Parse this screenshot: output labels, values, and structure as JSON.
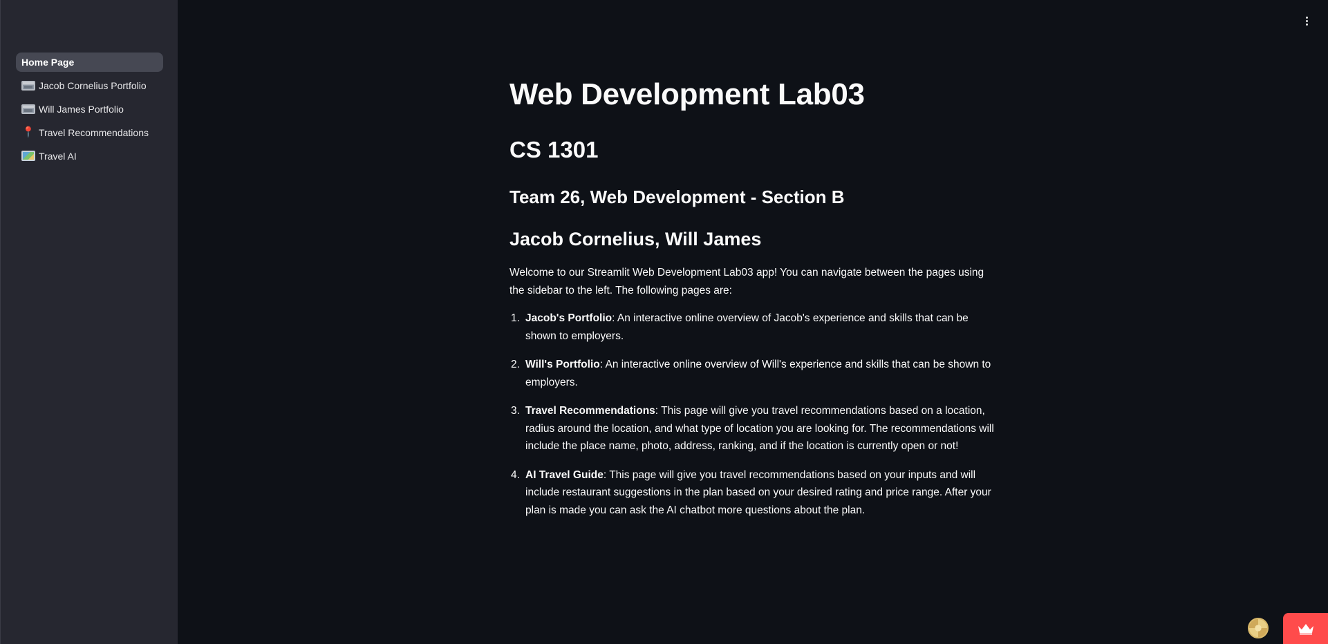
{
  "sidebar": {
    "items": [
      {
        "label": "Home Page",
        "icon": "none",
        "active": true
      },
      {
        "label": "Jacob Cornelius Portfolio",
        "icon": "framed-picture-icon",
        "active": false
      },
      {
        "label": "Will James Portfolio",
        "icon": "framed-picture-icon",
        "active": false
      },
      {
        "label": "Travel Recommendations",
        "icon": "round-pushpin-icon",
        "active": false
      },
      {
        "label": "Travel AI",
        "icon": "world-map-icon",
        "active": false
      }
    ]
  },
  "main": {
    "title": "Web Development Lab03",
    "course": "CS 1301",
    "team": "Team 26, Web Development - Section B",
    "authors": "Jacob Cornelius, Will James",
    "intro": "Welcome to our Streamlit Web Development Lab03 app! You can navigate between the pages using the sidebar to the left. The following pages are:",
    "pages": [
      {
        "num": "1.",
        "name": "Jacob's Portfolio",
        "desc": ": An interactive online overview of Jacob's experience and skills that can be shown to employers."
      },
      {
        "num": "2.",
        "name": "Will's Portfolio",
        "desc": ": An interactive online overview of Will's experience and skills that can be shown to employers."
      },
      {
        "num": "3.",
        "name": "Travel Recommendations",
        "desc": ": This page will give you travel recommendations based on a location, radius around the location, and what type of location you are looking for. The recommendations will include the place name, photo, address, ranking, and if the location is currently open or not!"
      },
      {
        "num": "4.",
        "name": "AI Travel Guide",
        "desc": ": This page will give you travel recommendations based on your inputs and will include restaurant suggestions in the plan based on your desired rating and price range. After your plan is made you can ask the AI chatbot more questions about the plan."
      }
    ]
  },
  "toolbar": {
    "menu_icon": "vertical-ellipsis-icon"
  },
  "footer": {
    "avatar_icon": "user-avatar-icon",
    "badge_icon": "crown-icon",
    "badge_color": "#ff4b4b"
  },
  "colors": {
    "background": "#0e1117",
    "sidebar": "#262730",
    "active_item": "#464853",
    "text": "#fafafa"
  }
}
